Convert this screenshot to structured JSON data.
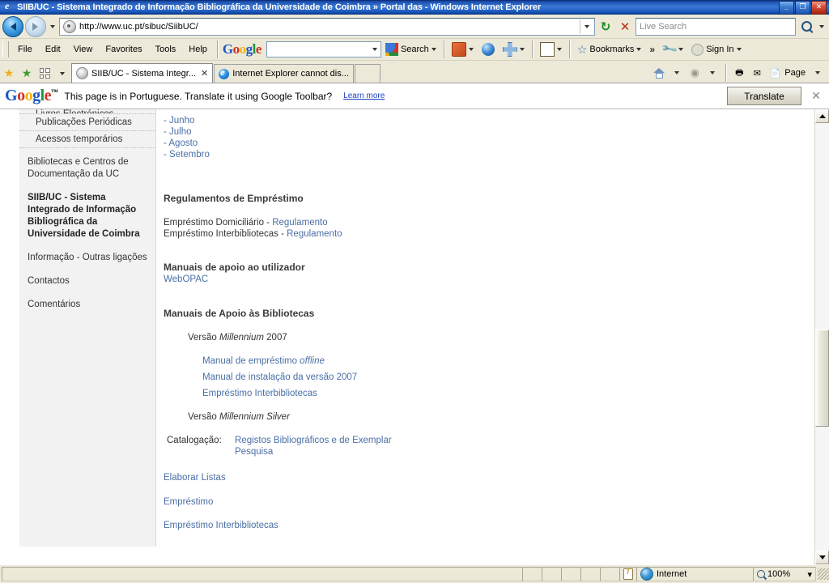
{
  "window": {
    "title": "SIIB/UC - Sistema Integrado de Informação Bibliográfica da Universidade de Coimbra » Portal das - Windows Internet Explorer",
    "minimize_label": "_",
    "maximize_label": "❐",
    "close_label": "✕"
  },
  "address_bar": {
    "url": "http://www.uc.pt/sibuc/SiibUC/",
    "search_placeholder": "Live Search",
    "back_title": "Back",
    "forward_title": "Forward",
    "refresh_glyph": "↻",
    "stop_glyph": "✕",
    "recent_caret": "▾"
  },
  "menu": {
    "items": [
      {
        "label": "File"
      },
      {
        "label": "Edit"
      },
      {
        "label": "View"
      },
      {
        "label": "Favorites"
      },
      {
        "label": "Tools"
      },
      {
        "label": "Help"
      }
    ]
  },
  "google_toolbar": {
    "logo_letters": [
      {
        "c": "G",
        "color": "b"
      },
      {
        "c": "o",
        "color": "r"
      },
      {
        "c": "o",
        "color": "y"
      },
      {
        "c": "g",
        "color": "b"
      },
      {
        "c": "l",
        "color": "g"
      },
      {
        "c": "e",
        "color": "r"
      }
    ],
    "logo_tm": "™",
    "search_field_value": "",
    "search_label": "Search",
    "bookmarks_label": "Bookmarks",
    "sign_in_label": "Sign In",
    "overflow_glyph": "»",
    "caret": "▾"
  },
  "tabs": {
    "quick_tabs_label": "Quick Tabs",
    "items": [
      {
        "label": "SIIB/UC - Sistema Integr...",
        "active": true,
        "close": "✕"
      },
      {
        "label": "Internet Explorer cannot dis...",
        "active": false,
        "close": ""
      }
    ],
    "right_tools": {
      "home_label": "Home",
      "feeds_label": "Feeds",
      "print_label": "Print",
      "page_label": "Page",
      "caret": "▾"
    }
  },
  "translate_bar": {
    "logo_letters": [
      {
        "c": "G",
        "color": "b"
      },
      {
        "c": "o",
        "color": "r"
      },
      {
        "c": "o",
        "color": "y"
      },
      {
        "c": "g",
        "color": "b"
      },
      {
        "c": "l",
        "color": "g"
      },
      {
        "c": "e",
        "color": "r"
      }
    ],
    "logo_tm": "™",
    "message": "This page is in Portuguese.  Translate it using Google Toolbar?",
    "learn_more": "Learn more",
    "translate_button": "Translate",
    "close": "✕"
  },
  "sidebar": {
    "clipped_item": "Livros Electrónicos",
    "sub_items": [
      {
        "label": "Publicações Periódicas"
      },
      {
        "label": "Acessos temporários"
      }
    ],
    "items": [
      {
        "label": "Bibliotecas e Centros de Documentação da UC",
        "bold": false
      },
      {
        "label": "SIIB/UC - Sistema Integrado de Informação Bibliográfica da Universidade de Coimbra",
        "bold": true
      },
      {
        "label": "Informação - Outras ligações",
        "bold": false
      },
      {
        "label": "Contactos",
        "bold": false
      },
      {
        "label": "Comentários",
        "bold": false
      }
    ]
  },
  "main": {
    "month_links": [
      {
        "label": "- Junho"
      },
      {
        "label": "- Julho"
      },
      {
        "label": "- Agosto"
      },
      {
        "label": "- Setembro"
      }
    ],
    "section_regulamentos": {
      "heading": "Regulamentos de Empréstimo",
      "rows": [
        {
          "text": "Empréstimo Domiciliário - ",
          "link": "Regulamento"
        },
        {
          "text": "Empréstimo Interbibliotecas - ",
          "link": "Regulamento"
        }
      ]
    },
    "section_manuais_utilizador": {
      "heading": "Manuais de apoio ao utilizador",
      "link": "WebOPAC"
    },
    "section_manuais_bibliotecas": {
      "heading": "Manuais de Apoio às Bibliotecas",
      "version_2007_prefix": "Versão ",
      "version_2007_italic": "Millennium",
      "version_2007_suffix": " 2007",
      "manual_links": [
        {
          "text": "Manual de empréstimo ",
          "italic": "offline"
        },
        {
          "text": "Manual de instalação da versão 2007",
          "italic": ""
        },
        {
          "text": "Empréstimo Interbibliotecas",
          "italic": ""
        }
      ],
      "version_silver_prefix": "Versão ",
      "version_silver_italic": "Millennium Silver",
      "catalogacao_label": "Catalogação:",
      "catalogacao_links": [
        {
          "label": "Registos Bibliográficos e de Exemplar"
        },
        {
          "label": "Pesquisa"
        }
      ]
    },
    "bottom_links": [
      {
        "label": "Elaborar Listas"
      },
      {
        "label": "Empréstimo"
      },
      {
        "label": "Empréstimo Interbibliotecas"
      }
    ]
  },
  "status_bar": {
    "message": "",
    "zone": "Internet",
    "zoom": "100%",
    "zoom_caret": "▾"
  },
  "colors": {
    "title_bar": "#1c52b0",
    "chrome": "#ece9d8",
    "link": "#4a6fa5",
    "sidebar_bg": "#f2f2f2",
    "heading": "#3a3a3a"
  }
}
